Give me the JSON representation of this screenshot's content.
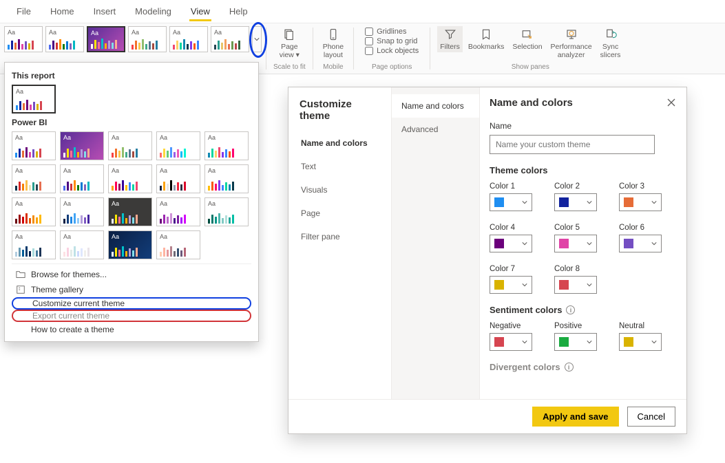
{
  "menubar": {
    "items": [
      "File",
      "Home",
      "Insert",
      "Modeling",
      "View",
      "Help"
    ],
    "active": "View"
  },
  "ribbon": {
    "themes_aa": "Aa",
    "scale_group": "Scale to fit",
    "page_view": "Page\nview ▾",
    "mobile_group": "Mobile",
    "phone_layout": "Phone\nlayout",
    "page_options_group": "Page options",
    "gridlines": "Gridlines",
    "snap": "Snap to grid",
    "lock": "Lock objects",
    "show_panes_group": "Show panes",
    "filters": "Filters",
    "bookmarks": "Bookmarks",
    "selection": "Selection",
    "perf": "Performance\nanalyzer",
    "sync": "Sync\nslicers"
  },
  "themes_panel": {
    "this_report": "This report",
    "power_bi": "Power BI",
    "browse": "Browse for themes...",
    "gallery": "Theme gallery",
    "customize": "Customize current theme",
    "export": "Export current theme",
    "howto": "How to create a theme"
  },
  "dialog": {
    "title": "Customize theme",
    "nav1": [
      "Name and colors",
      "Text",
      "Visuals",
      "Page",
      "Filter pane"
    ],
    "nav2": [
      "Name and colors",
      "Advanced"
    ],
    "heading": "Name and colors",
    "name_label": "Name",
    "name_placeholder": "Name your custom theme",
    "theme_colors": "Theme colors",
    "colors": [
      {
        "label": "Color 1",
        "hex": "#1f8ef1"
      },
      {
        "label": "Color 2",
        "hex": "#12239e"
      },
      {
        "label": "Color 3",
        "hex": "#e66c37"
      },
      {
        "label": "Color 4",
        "hex": "#6b007b"
      },
      {
        "label": "Color 5",
        "hex": "#e044a7"
      },
      {
        "label": "Color 6",
        "hex": "#744ec2"
      },
      {
        "label": "Color 7",
        "hex": "#d9b300"
      },
      {
        "label": "Color 8",
        "hex": "#d64550"
      }
    ],
    "sentiment_title": "Sentiment colors",
    "sentiment": [
      {
        "label": "Negative",
        "hex": "#d64550"
      },
      {
        "label": "Positive",
        "hex": "#1aab40"
      },
      {
        "label": "Neutral",
        "hex": "#d9b300"
      }
    ],
    "divergent": "Divergent colors",
    "apply": "Apply and save",
    "cancel": "Cancel"
  }
}
